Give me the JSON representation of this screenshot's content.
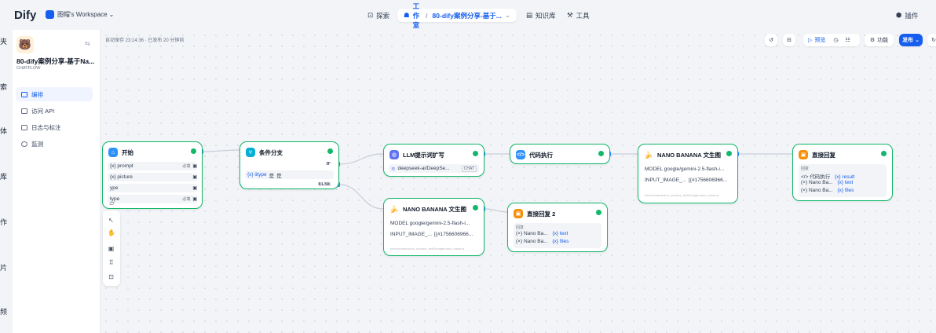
{
  "header": {
    "logo": "Dify",
    "workspace": "图帽's Workspace",
    "explore": "探索",
    "studio": "工作室",
    "app_crumb": "80-dify案例分享-基于...",
    "knowledge": "知识库",
    "tools": "工具",
    "plugins": "插件"
  },
  "left_edge": [
    "夹",
    "索",
    "体",
    "库",
    "作",
    "片",
    "频"
  ],
  "app": {
    "title": "80-dify案例分享-基于Na...",
    "type": "CHATFLOW"
  },
  "nav": [
    {
      "label": "编排"
    },
    {
      "label": "访问 API"
    },
    {
      "label": "日志与标注"
    },
    {
      "label": "监测"
    }
  ],
  "status": "自动保存 23:14:36 · 已发布 20 分钟前",
  "toolbar": {
    "preview": "预览",
    "features": "功能",
    "publish": "发布"
  },
  "nodes": {
    "start": {
      "title": "开始",
      "vars": [
        {
          "name": "{x} prompt",
          "tag": "必填"
        },
        {
          "name": "{x} picture",
          "tag": ""
        },
        {
          "name": "ype",
          "tag": ""
        },
        {
          "name": "type",
          "tag": "必填"
        }
      ]
    },
    "ifelse": {
      "title": "条件分支",
      "if": "IF",
      "cond_var": "{x} iitype",
      "cond_op": "是",
      "cond_val": "是",
      "else": "ELSE"
    },
    "llm": {
      "title": "LLM提示词扩写",
      "model": "deepseek-ai/DeepSe...",
      "mode": "CHAT"
    },
    "code": {
      "title": "代码执行"
    },
    "nano1": {
      "title": "NANO BANANA 文生图",
      "model": "MODEL google/gemini-2.5-flash-i...",
      "input": "INPUT_IMAGE_...",
      "input_val": "[{#1756606966...",
      "hint": "inner/nodes/nano_banana_text2image/nano_banana"
    },
    "reply1": {
      "title": "直接回复",
      "label": "回复",
      "items": [
        {
          "src": "代码执行",
          "var": "{x} result"
        },
        {
          "src": "Nano Ba...",
          "var": "{x} text"
        },
        {
          "src": "Nano Ba...",
          "var": "{x} files"
        }
      ]
    },
    "nano2": {
      "title": "NANO BANANA 文生图",
      "model": "MODEL google/gemini-2.5-flash-i...",
      "input": "INPUT_IMAGE_...",
      "input_val": "[{#1756606966...",
      "hint": "inner/nodes/nano_banana_text2image/nano_banana"
    },
    "reply2": {
      "title": "直接回复 2",
      "label": "回复",
      "items": [
        {
          "src": "Nano Ba...",
          "var": "{x} text"
        },
        {
          "src": "Nano Ba...",
          "var": "{x} files"
        }
      ]
    }
  },
  "colors": {
    "accent": "#155eef",
    "success": "#12b76a",
    "start": "#2e90fa",
    "ifelse": "#06aed4",
    "llm": "#6172f3",
    "code": "#2e90fa",
    "tool": "#fdb022",
    "answer": "#f79009"
  }
}
